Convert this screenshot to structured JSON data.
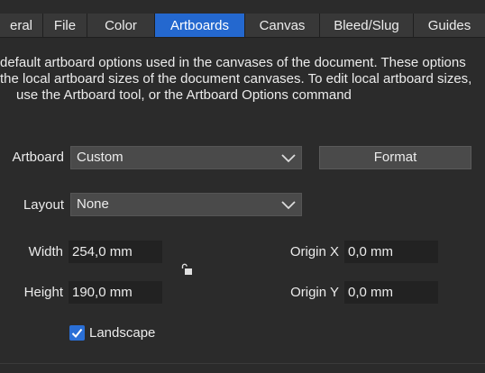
{
  "tabs": [
    {
      "label": "eral",
      "active": false
    },
    {
      "label": "File",
      "active": false
    },
    {
      "label": "Color",
      "active": false
    },
    {
      "label": "Artboards",
      "active": true
    },
    {
      "label": "Canvas",
      "active": false
    },
    {
      "label": "Bleed/Slug",
      "active": false
    },
    {
      "label": "Guides",
      "active": false
    }
  ],
  "description": [
    "default artboard options used in the canvases of the document. These options",
    "the local artboard sizes of the document canvases. To edit local artboard sizes,",
    "use the Artboard tool, or the Artboard Options command"
  ],
  "artboard": {
    "label": "Artboard",
    "value": "Custom",
    "format_button": "Format"
  },
  "layout": {
    "label": "Layout",
    "value": "None"
  },
  "width": {
    "label": "Width",
    "value": "254,0 mm"
  },
  "height": {
    "label": "Height",
    "value": "190,0 mm"
  },
  "origin_x": {
    "label": "Origin X",
    "value": "0,0 mm"
  },
  "origin_y": {
    "label": "Origin Y",
    "value": "0,0 mm"
  },
  "landscape": {
    "label": "Landscape",
    "checked": true
  },
  "colors": {
    "accent": "#2468cf",
    "background": "#2b2b2b",
    "field": "#222222"
  },
  "icons": [
    "chevron-down-icon",
    "lock-open-icon",
    "checkmark-icon"
  ]
}
